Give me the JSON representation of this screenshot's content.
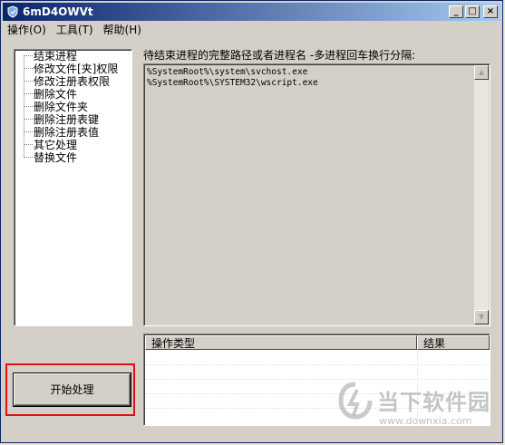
{
  "window": {
    "title": "6mD4OWVt",
    "minimize": "_",
    "maximize": "□",
    "close": "×"
  },
  "menu": [
    {
      "label": "操作(O)"
    },
    {
      "label": "工具(T)"
    },
    {
      "label": "帮助(H)"
    }
  ],
  "tree": {
    "items": [
      {
        "label": "结束进程"
      },
      {
        "label": "修改文件[夹]权限"
      },
      {
        "label": "修改注册表权限"
      },
      {
        "label": "删除文件"
      },
      {
        "label": "删除文件夹"
      },
      {
        "label": "删除注册表键"
      },
      {
        "label": "删除注册表值"
      },
      {
        "label": "其它处理"
      },
      {
        "label": "替换文件"
      }
    ]
  },
  "main": {
    "prompt": "待结束进程的完整路径或者进程名 -多进程回车换行分隔:",
    "lines": [
      "%SystemRoot%\\system\\svchost.exe",
      "%SystemRoot%\\SYSTEM32\\wscript.exe"
    ],
    "scroll_up": "▲",
    "scroll_down": "▼"
  },
  "table": {
    "columns": [
      "操作类型",
      "结果"
    ]
  },
  "actions": {
    "start_label": "开始处理"
  },
  "watermark": {
    "brand": "当下软件园",
    "url": "www.downxia.com"
  },
  "colors": {
    "titlebar": "#0a246a",
    "highlight": "#e01010",
    "face": "#d4d0c8"
  }
}
